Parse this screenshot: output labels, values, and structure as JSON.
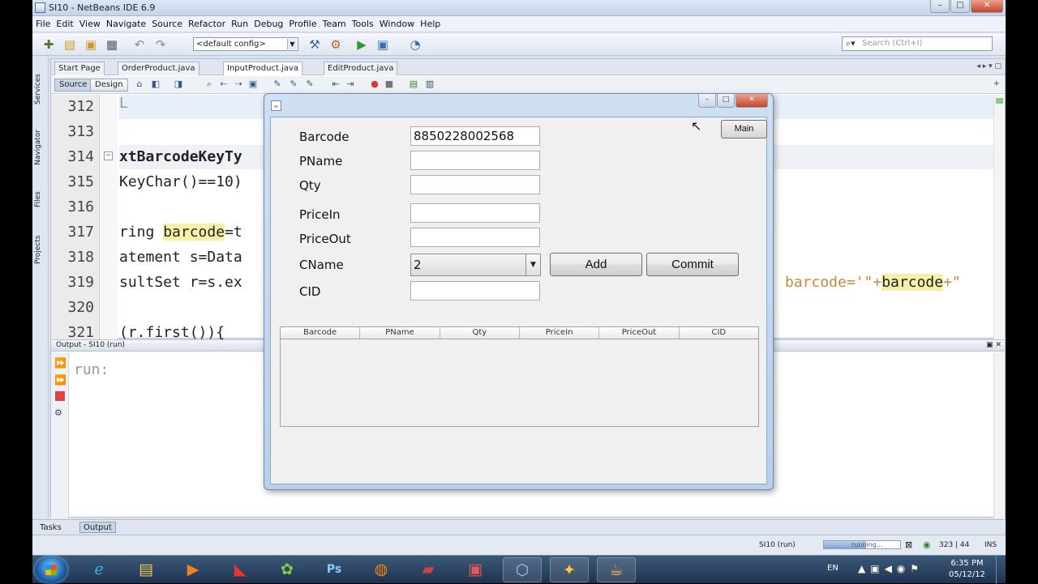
{
  "window": {
    "title": "SI10 - NetBeans IDE 6.9"
  },
  "menu": [
    "File",
    "Edit",
    "View",
    "Navigate",
    "Source",
    "Refactor",
    "Run",
    "Debug",
    "Profile",
    "Team",
    "Tools",
    "Window",
    "Help"
  ],
  "toolbar": {
    "config": "<default config>",
    "search_placeholder": "Search (Ctrl+I)"
  },
  "side_tabs": [
    "Services",
    "Navigator",
    "Files",
    "Projects"
  ],
  "editor": {
    "tabs": [
      "Start Page",
      "OrderProduct.java",
      "InputProduct.java",
      "EditProduct.java"
    ],
    "modes": [
      "Source",
      "Design"
    ],
    "line_numbers": [
      "312",
      "313",
      "314",
      "315",
      "316",
      "317",
      "318",
      "319",
      "320",
      "321"
    ],
    "code": {
      "l312": "L",
      "l314": "xtBarcodeKeyTy",
      "l315": "KeyChar()==10)",
      "l317a": "ring ",
      "l317b": "barcode",
      "l317c": "=t",
      "l318": "atement s=Data",
      "l319": "sultSet r=s.ex",
      "l319_right_a": "barcode='\"+",
      "l319_right_b": "barcode",
      "l319_right_c": "+\"",
      "l321": "(r.first()){"
    }
  },
  "output": {
    "title": "Output - SI10 (run)",
    "text": "run:"
  },
  "bottom_tabs": [
    "Tasks",
    "Output"
  ],
  "status": {
    "process": "SI10 (run)",
    "progress_text": "running...",
    "progress": 0.55,
    "position": "323 | 44",
    "mode": "INS"
  },
  "dialog": {
    "main_button": "Main",
    "fields": [
      {
        "label": "Barcode",
        "value": "8850228002568"
      },
      {
        "label": "PName",
        "value": ""
      },
      {
        "label": "Qty",
        "value": ""
      },
      {
        "label": "PriceIn",
        "value": ""
      },
      {
        "label": "PriceOut",
        "value": ""
      },
      {
        "label": "CName",
        "value": "2"
      },
      {
        "label": "CID",
        "value": ""
      }
    ],
    "add_button": "Add",
    "commit_button": "Commit",
    "table_headers": [
      "Barcode",
      "PName",
      "Qty",
      "PriceIn",
      "PriceOut",
      "CID"
    ]
  },
  "taskbar": {
    "lang": "EN",
    "time": "6:35 PM",
    "date": "05/12/12"
  }
}
